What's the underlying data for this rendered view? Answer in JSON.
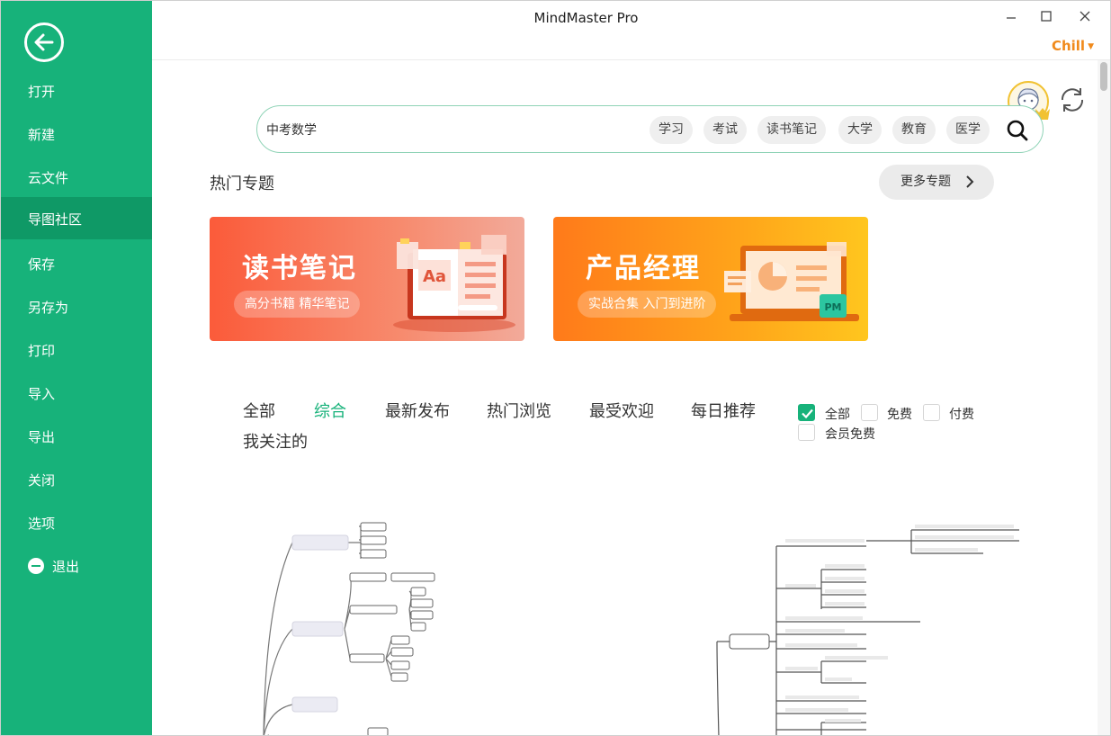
{
  "window": {
    "title": "MindMaster Pro",
    "user_name": "Chill"
  },
  "sidebar": {
    "items": [
      {
        "label": "打开"
      },
      {
        "label": "新建"
      },
      {
        "label": "云文件"
      },
      {
        "label": "导图社区",
        "active": true
      },
      {
        "label": "保存"
      },
      {
        "label": "另存为"
      },
      {
        "label": "打印"
      },
      {
        "label": "导入"
      },
      {
        "label": "导出"
      },
      {
        "label": "关闭"
      },
      {
        "label": "选项"
      },
      {
        "label": "退出",
        "icon": "exit-icon"
      }
    ]
  },
  "search": {
    "value": "中考数学",
    "tags": [
      "学习",
      "考试",
      "读书笔记",
      "大学",
      "教育",
      "医学"
    ]
  },
  "hot_topics": {
    "title": "热门专题",
    "more_label": "更多专题",
    "banners": [
      {
        "title": "读书笔记",
        "subtitle": "高分书籍 精华笔记",
        "icon_text": "Aa"
      },
      {
        "title": "产品经理",
        "subtitle": "实战合集 入门到进阶",
        "icon_text": "PM"
      }
    ]
  },
  "filters": {
    "tabs": [
      {
        "label": "全部"
      },
      {
        "label": "综合",
        "active": true
      },
      {
        "label": "最新发布"
      },
      {
        "label": "热门浏览"
      },
      {
        "label": "最受欢迎"
      },
      {
        "label": "每日推荐"
      },
      {
        "label": "我关注的"
      }
    ],
    "price": [
      {
        "label": "全部",
        "checked": true
      },
      {
        "label": "免费",
        "checked": false
      },
      {
        "label": "付费",
        "checked": false
      },
      {
        "label": "会员免费",
        "checked": false
      }
    ]
  },
  "colors": {
    "brand": "#17b27a",
    "accent_orange": "#f08a1c"
  }
}
